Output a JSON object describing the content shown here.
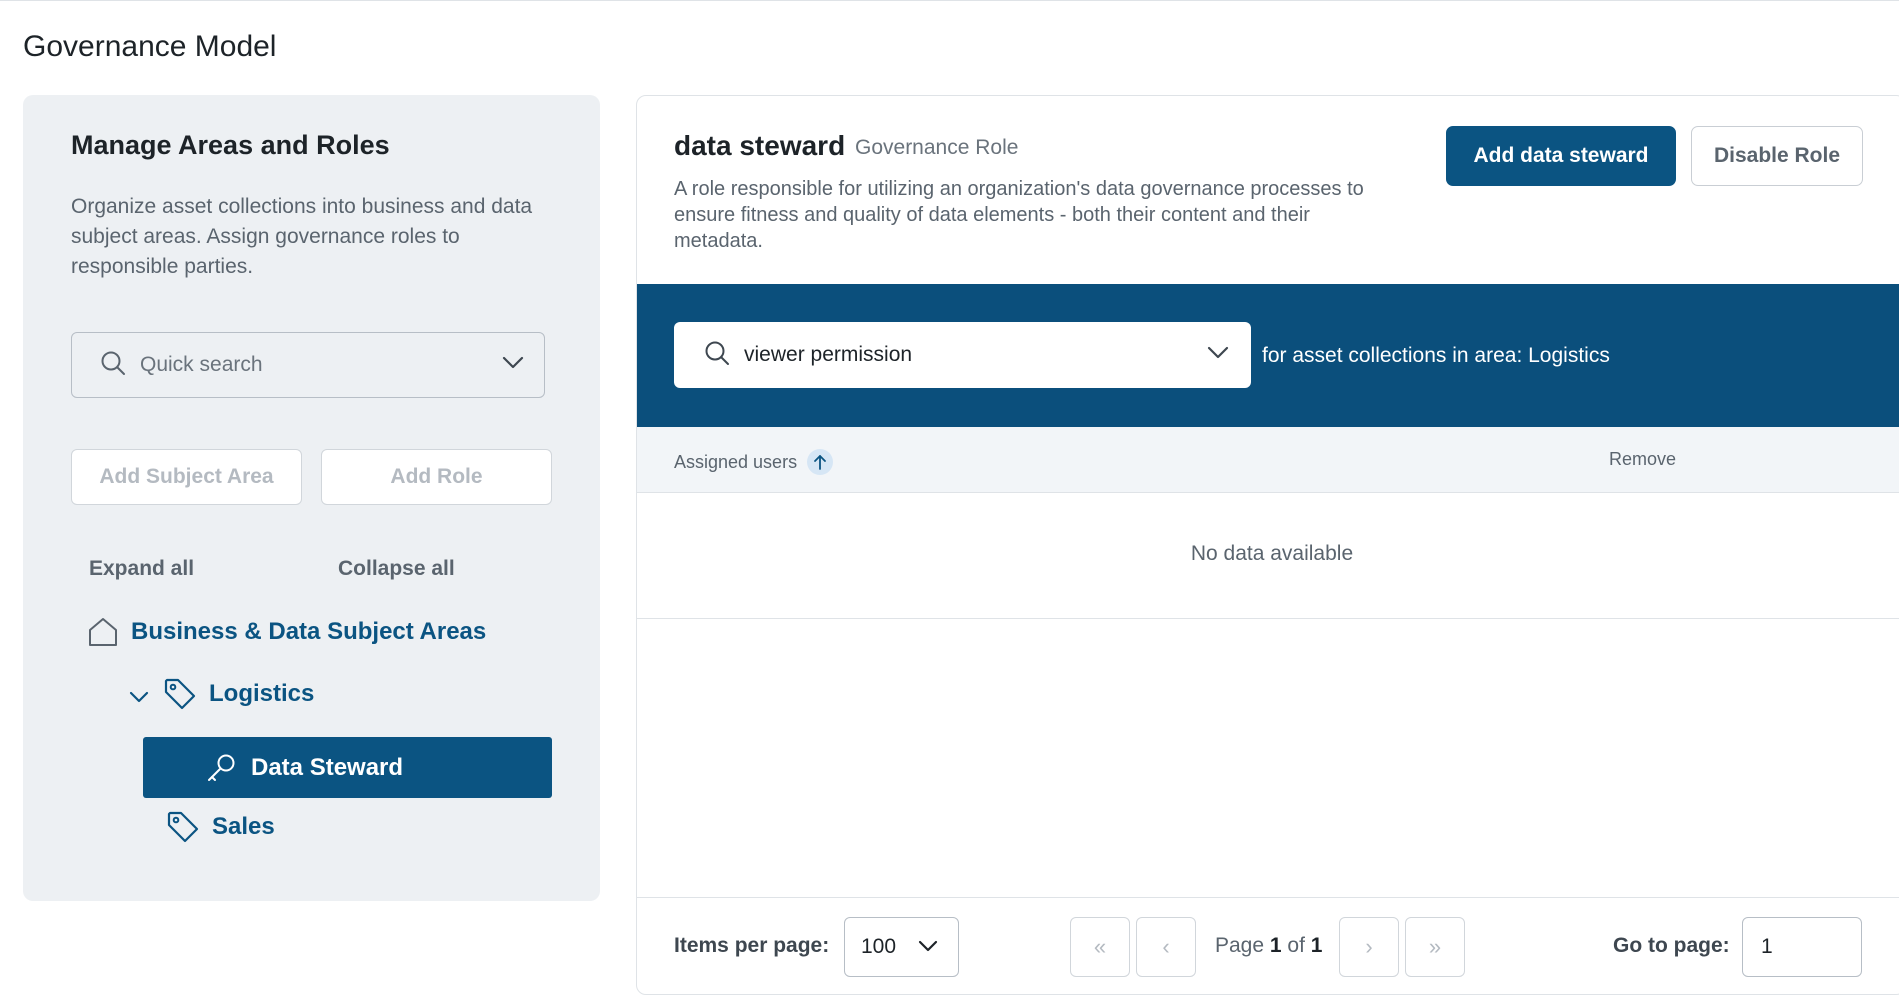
{
  "page": {
    "title": "Governance Model"
  },
  "left_panel": {
    "title": "Manage Areas and Roles",
    "description": "Organize asset collections into business and data subject areas. Assign governance roles to responsible parties.",
    "search_placeholder": "Quick search",
    "add_subject_area_label": "Add Subject Area",
    "add_role_label": "Add Role",
    "expand_all_label": "Expand all",
    "collapse_all_label": "Collapse all",
    "tree": {
      "root_label": "Business & Data Subject Areas",
      "logistics_label": "Logistics",
      "data_steward_label": "Data Steward",
      "sales_label": "Sales"
    }
  },
  "role_detail": {
    "name": "data steward",
    "type_label": "Governance Role",
    "description": "A role responsible for utilizing an organization's data governance processes to ensure fitness and quality of data elements - both their content and their metadata.",
    "add_button_label": "Add data steward",
    "disable_button_label": "Disable Role"
  },
  "permission_bar": {
    "selected_permission": "viewer permission",
    "context_text": "for asset collections in area: Logistics"
  },
  "table": {
    "columns": {
      "assigned_users": "Assigned users",
      "remove": "Remove"
    },
    "empty_text": "No data available"
  },
  "pagination": {
    "items_per_page_label": "Items per page:",
    "items_per_page_value": "100",
    "page_word": "Page",
    "of_word": "of",
    "current_page": "1",
    "total_pages": "1",
    "go_to_page_label": "Go to page:",
    "go_to_page_value": "1"
  },
  "colors": {
    "brand": "#0b5482",
    "banner": "#0b4f7c",
    "panel_bg": "#edf0f3"
  }
}
